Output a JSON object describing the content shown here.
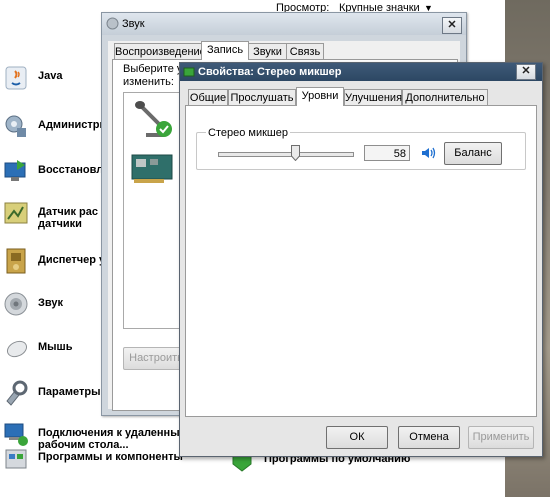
{
  "view_bar": {
    "label": "Просмотр:",
    "value": "Крупные значки",
    "arrow": "▼"
  },
  "control_panel": {
    "items": [
      {
        "label": "Java",
        "icon": "java-icon"
      },
      {
        "label": "Администрирование",
        "icon": "admin-tools-icon"
      },
      {
        "label": "Восстановление",
        "icon": "recovery-icon"
      },
      {
        "label": "Датчик расположения и другие датчики",
        "icon": "sensor-icon"
      },
      {
        "label": "Диспетчер устройств",
        "icon": "device-manager-icon"
      },
      {
        "label": "Звук",
        "icon": "speaker-icon"
      },
      {
        "label": "Мышь",
        "icon": "mouse-icon"
      },
      {
        "label": "Параметры",
        "icon": "options-icon"
      },
      {
        "label": "Подключения к удаленным рабочим столам",
        "icon": "remote-desktop-icon"
      },
      {
        "label": "Программы и компоненты",
        "icon": "programs-icon"
      },
      {
        "label": "Программы по умолчанию",
        "icon": "default-programs-icon"
      }
    ],
    "labels_visible": {
      "java": "Java",
      "admin": "Администри",
      "recovery": "Восстановле",
      "sensor_line1": "Датчик рас",
      "sensor_line2": "датчики",
      "device_mgr": "Диспетчер у",
      "sound": "Звук",
      "mouse": "Мышь",
      "params": "Параметры",
      "remote_line1": "Подключения к удаленны",
      "remote_line2": "рабочим стола...",
      "programs": "Программы и компоненты",
      "default_programs": "Программы по умолчанию"
    }
  },
  "sound_window": {
    "title": "Звук",
    "close": "✕",
    "tabs": [
      "Воспроизведение",
      "Запись",
      "Звуки",
      "Связь"
    ],
    "active_tab": "Запись",
    "instruction_line1": "Выберите у",
    "instruction_line2": "изменить:",
    "configure_button": "Настроить"
  },
  "properties_dialog": {
    "title": "Свойства: Стерео микшер",
    "close": "✕",
    "tabs": [
      "Общие",
      "Прослушать",
      "Уровни",
      "Улучшения",
      "Дополнительно"
    ],
    "active_tab": "Уровни",
    "group_label": "Стерео микшер",
    "level_value": "58",
    "level_fraction": 0.58,
    "balance_button": "Баланс",
    "ok_button": "ОК",
    "cancel_button": "Отмена",
    "apply_button": "Применить"
  },
  "colors": {
    "title_active": "#2d4763",
    "accent": "#1e6fd0"
  }
}
